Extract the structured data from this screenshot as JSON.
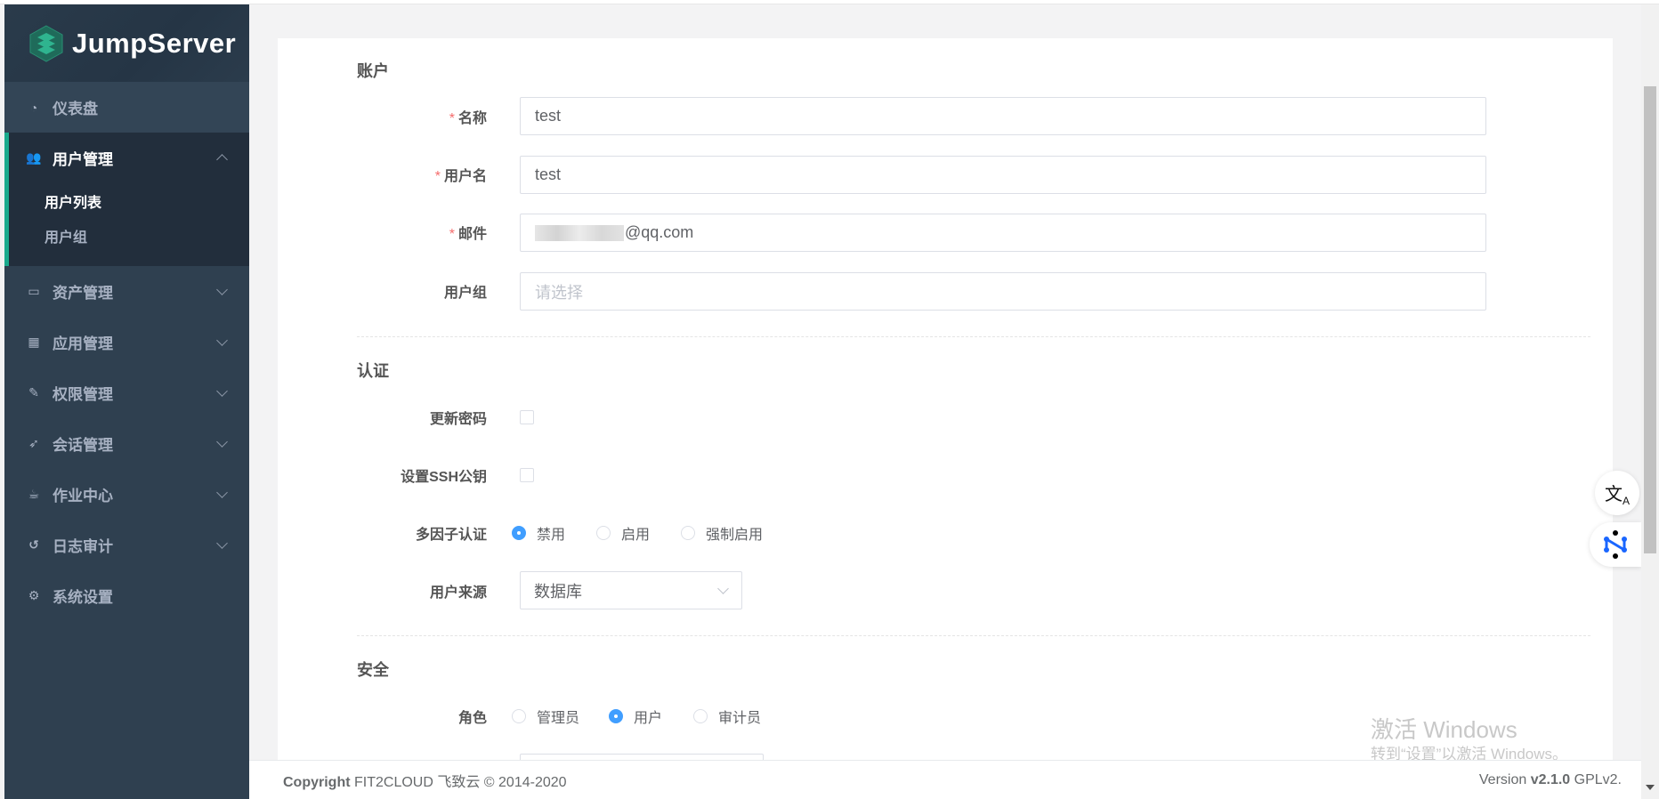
{
  "sidebar": {
    "logo": "JumpServer",
    "dashboard": "仪表盘",
    "user_mgmt": "用户管理",
    "user_list": "用户列表",
    "user_group": "用户组",
    "items": [
      "资产管理",
      "应用管理",
      "权限管理",
      "会话管理",
      "作业中心",
      "日志审计",
      "系统设置"
    ]
  },
  "form": {
    "account_title": "账户",
    "name_label": "名称",
    "name_value": "test",
    "username_label": "用户名",
    "username_value": "test",
    "email_label": "邮件",
    "email_value": "@qq.com",
    "group_label": "用户组",
    "group_placeholder": "请选择",
    "auth_title": "认证",
    "update_password_label": "更新密码",
    "ssh_key_label": "设置SSH公钥",
    "mfa_label": "多因子认证",
    "mfa_options": [
      "禁用",
      "启用",
      "强制启用"
    ],
    "mfa_selected": 0,
    "source_label": "用户来源",
    "source_value": "数据库",
    "security_title": "安全",
    "role_label": "角色",
    "role_options": [
      "管理员",
      "用户",
      "审计员"
    ],
    "role_selected": 1,
    "required_mark": "*"
  },
  "footer": {
    "copyright_bold": "Copyright",
    "copyright": "FIT2CLOUD 飞致云 © 2014-2020",
    "version_prefix": "Version",
    "version": "v2.1.0",
    "license": "GPLv2."
  },
  "watermark": {
    "line1": "激活 Windows",
    "line2": "转到“设置”以激活 Windows。"
  },
  "colors": {
    "accent": "#19aa8d",
    "primary": "#409eff",
    "sidebar": "#2f4050"
  }
}
